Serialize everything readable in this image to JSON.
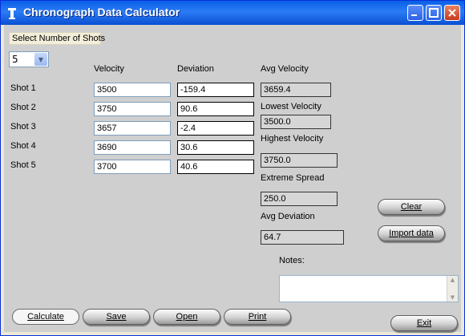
{
  "window": {
    "title": "Chronograph Data Calculator"
  },
  "shots_selector": {
    "label": "Select Number of Shots",
    "value": "5"
  },
  "columns": {
    "velocity": "Velocity",
    "deviation": "Deviation"
  },
  "shots": [
    {
      "label": "Shot 1",
      "velocity": "3500",
      "deviation": "-159.4"
    },
    {
      "label": "Shot 2",
      "velocity": "3750",
      "deviation": "90.6"
    },
    {
      "label": "Shot 3",
      "velocity": "3657",
      "deviation": "-2.4"
    },
    {
      "label": "Shot 4",
      "velocity": "3690",
      "deviation": "30.6"
    },
    {
      "label": "Shot 5",
      "velocity": "3700",
      "deviation": "40.6"
    }
  ],
  "stats": {
    "avg_velocity": {
      "label": "Avg Velocity",
      "value": "3659.4"
    },
    "lowest_velocity": {
      "label": "Lowest Velocity",
      "value": "3500.0"
    },
    "highest_velocity": {
      "label": "Highest Velocity",
      "value": "3750.0"
    },
    "extreme_spread": {
      "label": "Extreme Spread",
      "value": "250.0"
    },
    "avg_deviation": {
      "label": "Avg Deviation",
      "value": "64.7"
    }
  },
  "notes": {
    "label": "Notes:",
    "value": ""
  },
  "buttons": {
    "clear": "Clear",
    "import": "Import data",
    "calculate": "Calculate",
    "save": "Save",
    "open": "Open",
    "print": "Print",
    "exit": "Exit"
  }
}
